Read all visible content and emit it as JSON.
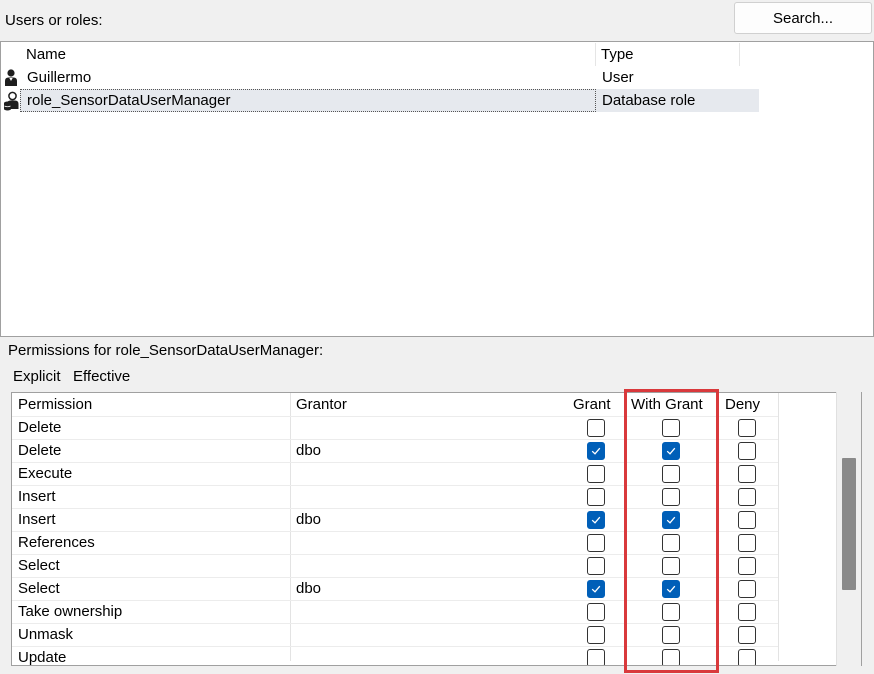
{
  "users_label": "Users or roles:",
  "search_button": "Search...",
  "users_table": {
    "columns": [
      "Name",
      "Type"
    ],
    "rows": [
      {
        "name": "Guillermo",
        "type": "User",
        "icon": "user-icon"
      },
      {
        "name": "role_SensorDataUserManager",
        "type": "Database role",
        "icon": "database-role-icon",
        "selected": true
      }
    ]
  },
  "permissions_label": "Permissions for role_SensorDataUserManager:",
  "tabs": [
    "Explicit",
    "Effective"
  ],
  "perm_table": {
    "columns": [
      "Permission",
      "Grantor",
      "Grant",
      "With Grant",
      "Deny"
    ],
    "rows": [
      {
        "permission": "Delete",
        "grantor": "",
        "grant": false,
        "with_grant": false,
        "deny": false
      },
      {
        "permission": "Delete",
        "grantor": "dbo",
        "grant": true,
        "with_grant": true,
        "deny": false
      },
      {
        "permission": "Execute",
        "grantor": "",
        "grant": false,
        "with_grant": false,
        "deny": false
      },
      {
        "permission": "Insert",
        "grantor": "",
        "grant": false,
        "with_grant": false,
        "deny": false
      },
      {
        "permission": "Insert",
        "grantor": "dbo",
        "grant": true,
        "with_grant": true,
        "deny": false
      },
      {
        "permission": "References",
        "grantor": "",
        "grant": false,
        "with_grant": false,
        "deny": false
      },
      {
        "permission": "Select",
        "grantor": "",
        "grant": false,
        "with_grant": false,
        "deny": false
      },
      {
        "permission": "Select",
        "grantor": "dbo",
        "grant": true,
        "with_grant": true,
        "deny": false
      },
      {
        "permission": "Take ownership",
        "grantor": "",
        "grant": false,
        "with_grant": false,
        "deny": false
      },
      {
        "permission": "Unmask",
        "grantor": "",
        "grant": false,
        "with_grant": false,
        "deny": false
      },
      {
        "permission": "Update",
        "grantor": "",
        "grant": false,
        "with_grant": false,
        "deny": false
      }
    ]
  },
  "colors": {
    "check_on": "#005fb8",
    "highlight": "#d9393c",
    "selection": "#e6e9ee"
  }
}
